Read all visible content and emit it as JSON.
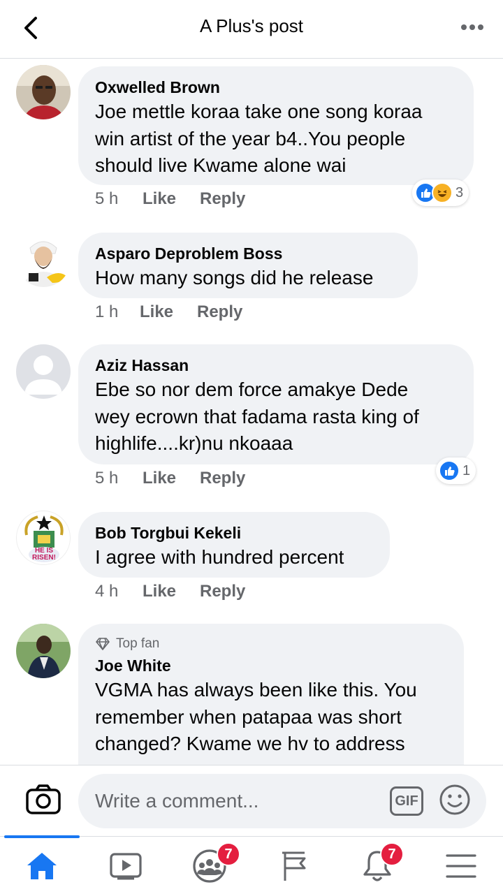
{
  "header": {
    "title": "A Plus's post"
  },
  "comments": [
    {
      "author": "Oxwelled Brown",
      "text": [
        "Joe mettle koraa take one song koraa",
        "win artist of the year b4..You people",
        "should live Kwame alone wai"
      ],
      "time": "5 h",
      "like": "Like",
      "reply": "Reply",
      "reactions": {
        "types": [
          "like",
          "haha"
        ],
        "count": "3"
      }
    },
    {
      "author": "Asparo Deproblem Boss",
      "text": [
        "How many songs did he release"
      ],
      "time": "1 h",
      "like": "Like",
      "reply": "Reply"
    },
    {
      "author": "Aziz Hassan",
      "text": [
        "Ebe so nor dem force amakye Dede",
        "wey ecrown that fadama rasta king of",
        "highlife....kr)nu nkoaaa"
      ],
      "time": "5 h",
      "like": "Like",
      "reply": "Reply",
      "reactions": {
        "types": [
          "like"
        ],
        "count": "1"
      }
    },
    {
      "author": "Bob Torgbui Kekeli",
      "text": [
        "I agree with hundred percent"
      ],
      "time": "4 h",
      "like": "Like",
      "reply": "Reply",
      "avatar_text": [
        "HE IS",
        "RISEN!"
      ]
    },
    {
      "badge": "Top fan",
      "author": "Joe White",
      "text": [
        "VGMA has always been like this. You",
        "remember when patapaa was short",
        "changed? Kwame we hv to address"
      ]
    }
  ],
  "composer": {
    "placeholder": "Write a comment...",
    "gif_label": "GIF"
  },
  "nav": {
    "items": [
      "home-icon",
      "watch-icon",
      "groups-icon",
      "pages-icon",
      "notifications-icon",
      "menu-icon"
    ],
    "active": "home-icon",
    "groups_badge": "7",
    "notifications_badge": "7"
  },
  "colors": {
    "accent": "#1877f2",
    "badge": "#e41e3f",
    "bubble": "#f0f2f5",
    "secondary_text": "#65676b",
    "haha": "#f7b125"
  }
}
